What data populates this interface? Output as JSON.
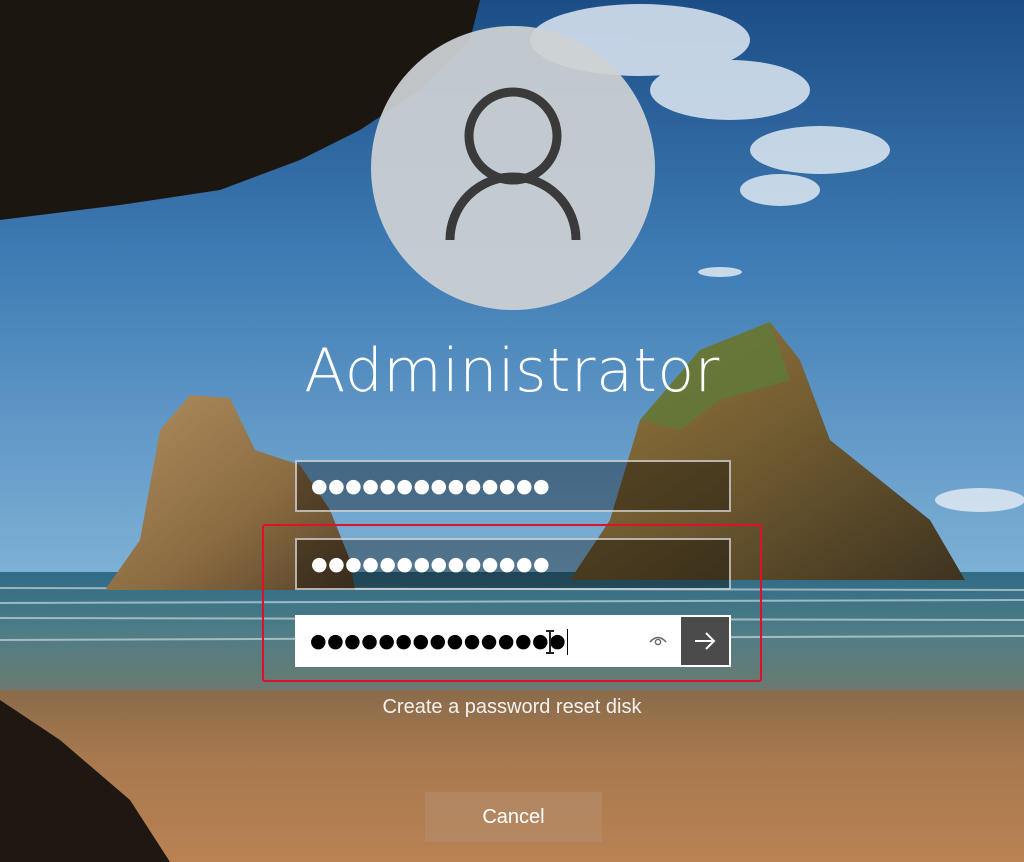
{
  "user": {
    "name": "Administrator"
  },
  "fields": {
    "old_password_mask": "●●●●●●●●●●●●●●",
    "new_password_mask": "●●●●●●●●●●●●●●",
    "confirm_password_mask": "●●●●●●●●●●●●●●●"
  },
  "links": {
    "reset_disk": "Create a password reset disk"
  },
  "buttons": {
    "cancel": "Cancel"
  },
  "icons": {
    "avatar": "user-icon",
    "reveal": "eye-icon",
    "submit": "arrow-right-icon",
    "cursor": "text-cursor-icon"
  },
  "colors": {
    "highlight_border": "#e0102a",
    "submit_button": "#4b4b4b",
    "cancel_button": "#b48a68"
  }
}
